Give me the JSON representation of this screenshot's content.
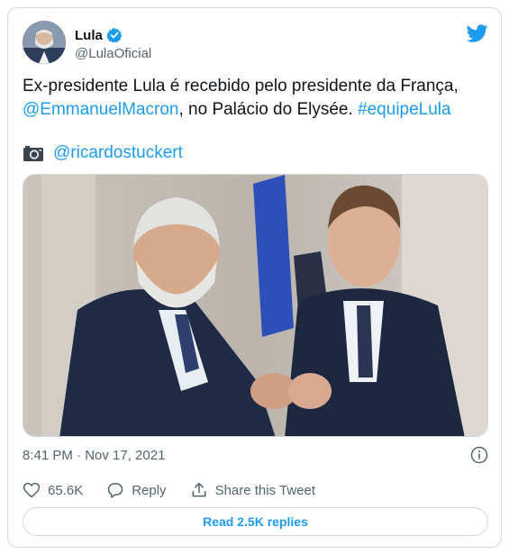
{
  "user": {
    "display_name": "Lula",
    "handle": "@LulaOficial"
  },
  "tweet": {
    "text_part1": "Ex-presidente Lula é recebido pelo presidente da França,",
    "mention": "@EmmanuelMacron",
    "text_part2": ", no Palácio do Elysée.",
    "hashtag": "#equipeLula",
    "photo_credit": "@ricardostuckert"
  },
  "meta": {
    "timestamp": "8:41 PM · Nov 17, 2021"
  },
  "actions": {
    "likes": "65.6K",
    "reply_label": "Reply",
    "share_label": "Share this Tweet"
  },
  "read_replies": "Read 2.5K replies",
  "colors": {
    "accent": "#1d9bf0",
    "secondary_text": "#536471",
    "border": "#cfd9de"
  },
  "icons": [
    "verified-badge-icon",
    "twitter-bird-icon",
    "camera-icon",
    "info-icon",
    "heart-icon",
    "reply-icon",
    "share-icon"
  ]
}
